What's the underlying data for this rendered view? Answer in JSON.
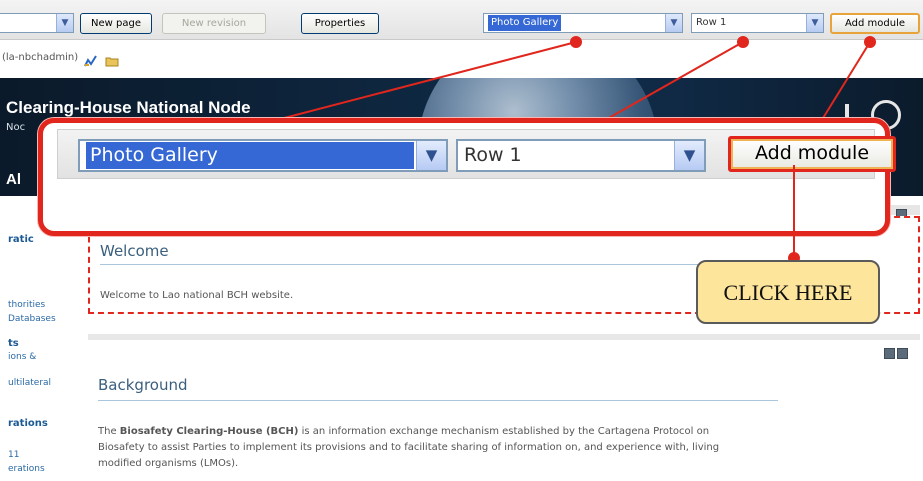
{
  "toolbar": {
    "buttons": {
      "new_page": "New page",
      "new_revision": "New revision",
      "properties": "Properties",
      "add_module": "Add module"
    },
    "module_select": "Photo Gallery",
    "row_select": "Row 1"
  },
  "user": {
    "label": "(la-nbchadmin)"
  },
  "banner": {
    "title": "Clearing-House National Node",
    "fragment_line2": "Noc",
    "fragment_line3": "Al"
  },
  "zoom": {
    "module_select": "Photo Gallery",
    "row_select": "Row 1",
    "add_module": "Add module"
  },
  "callout": {
    "text": "CLICK HERE"
  },
  "left_nav": {
    "items": [
      {
        "text": "ratic",
        "bold": true
      },
      {
        "text": "thorities",
        "bold": false
      },
      {
        "text": "Databases",
        "bold": false
      },
      {
        "text": "ts",
        "bold": true
      },
      {
        "text": "ions &",
        "bold": false
      },
      {
        "text": "ultilateral",
        "bold": false
      },
      {
        "text": "rations",
        "bold": true
      },
      {
        "text": "11",
        "bold": false
      },
      {
        "text": "erations",
        "bold": false
      }
    ]
  },
  "welcome": {
    "title": "Welcome",
    "text": "Welcome to Lao national BCH website."
  },
  "background": {
    "title": "Background",
    "text_before": "The ",
    "text_bold": "Biosafety Clearing-House (BCH)",
    "text_after": " is an information exchange mechanism established by the Cartagena Protocol on",
    "text_line2": "Biosafety to assist Parties to implement its provisions and to facilitate sharing of information on, and experience with, living",
    "text_line3": "modified organisms (LMOs)."
  },
  "colors": {
    "highlight_red": "#e0261d",
    "callout_yellow": "#fde59b",
    "selection_blue": "#3568d4",
    "banner_dark": "#0e2740"
  },
  "icons": [
    "chevron-down-icon",
    "edit-pencil-icon",
    "folder-icon",
    "module-minimize-icon",
    "module-close-icon"
  ]
}
